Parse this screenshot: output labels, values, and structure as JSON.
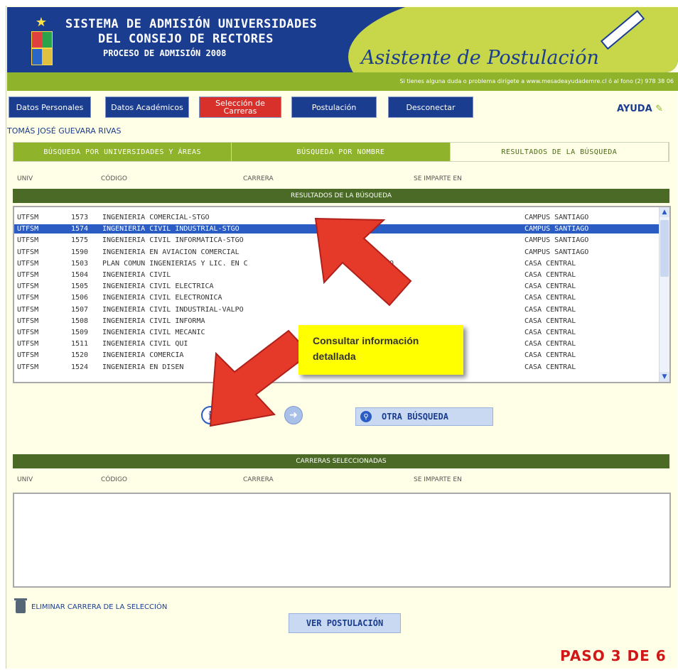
{
  "header": {
    "title_line1": "SISTEMA DE ADMISIÓN UNIVERSIDADES",
    "title_line2": "DEL CONSEJO DE RECTORES",
    "title_line3": "PROCESO DE ADMISIÓN 2008",
    "assistant_title": "Asistente de Postulación"
  },
  "infobar": {
    "text": "Si tienes alguna duda o problema dirígete a www.mesadeayudademre.cl ó al fono (2) 978 38 06"
  },
  "nav": {
    "items": [
      "Datos Personales",
      "Datos Académicos",
      "Selección de Carreras",
      "Postulación",
      "Desconectar"
    ],
    "help": "AYUDA"
  },
  "user": {
    "name": "TOMÁS JOSÉ GUEVARA RIVAS"
  },
  "tabs": [
    "BÚSQUEDA POR UNIVERSIDADES Y ÁREAS",
    "BÚSQUEDA POR NOMBRE",
    "RESULTADOS DE LA BÚSQUEDA"
  ],
  "columns": [
    "UNIV",
    "CÓDIGO",
    "CARRERA",
    "SE IMPARTE EN"
  ],
  "results": {
    "title": "RESULTADOS DE LA BÚSQUEDA",
    "rows": [
      {
        "univ": "UTFSM",
        "code": "1573",
        "career": "INGENIERIA COMERCIAL-STGO",
        "place": "CAMPUS SANTIAGO"
      },
      {
        "univ": "UTFSM",
        "code": "1574",
        "career": "INGENIERIA CIVIL INDUSTRIAL-STGO",
        "place": "CAMPUS SANTIAGO"
      },
      {
        "univ": "UTFSM",
        "code": "1575",
        "career": "INGENIERIA CIVIL INFORMATICA-STGO",
        "place": "CAMPUS SANTIAGO"
      },
      {
        "univ": "UTFSM",
        "code": "1590",
        "career": "INGENIERIA EN AVIACION COMERCIAL",
        "place": "CAMPUS SANTIAGO"
      },
      {
        "univ": "UTFSM",
        "code": "1503",
        "career": "PLAN COMUN INGENIERIAS Y LIC. EN C",
        "career_end": "LPO",
        "place": "CASA CENTRAL"
      },
      {
        "univ": "UTFSM",
        "code": "1504",
        "career": "INGENIERIA CIVIL",
        "place": "CASA CENTRAL"
      },
      {
        "univ": "UTFSM",
        "code": "1505",
        "career": "INGENIERIA CIVIL ELECTRICA",
        "place": "CASA CENTRAL"
      },
      {
        "univ": "UTFSM",
        "code": "1506",
        "career": "INGENIERIA CIVIL ELECTRONICA",
        "place": "CASA CENTRAL"
      },
      {
        "univ": "UTFSM",
        "code": "1507",
        "career": "INGENIERIA CIVIL INDUSTRIAL-VALPO",
        "place": "CASA CENTRAL"
      },
      {
        "univ": "UTFSM",
        "code": "1508",
        "career": "INGENIERIA CIVIL INFORMA",
        "place": "CASA CENTRAL"
      },
      {
        "univ": "UTFSM",
        "code": "1509",
        "career": "INGENIERIA CIVIL MECANIC",
        "place": "CASA CENTRAL"
      },
      {
        "univ": "UTFSM",
        "code": "1511",
        "career": "INGENIERIA CIVIL QUI",
        "place": "CASA CENTRAL"
      },
      {
        "univ": "UTFSM",
        "code": "1520",
        "career": "INGENIERIA COMERCIA",
        "place": "CASA CENTRAL"
      },
      {
        "univ": "UTFSM",
        "code": "1524",
        "career": "INGENIERIA EN DISEN",
        "place": "CASA CENTRAL"
      }
    ],
    "selected_index": 1
  },
  "tooltip": {
    "text": "Consultar información detallada"
  },
  "actions": {
    "info_glyph": "i",
    "other_search": "OTRA BÚSQUEDA"
  },
  "selected": {
    "title": "CARRERAS SELECCIONADAS"
  },
  "footer": {
    "remove": "ELIMINAR CARRERA DE LA SELECCIÓN",
    "view": "VER POSTULACIÓN",
    "step": "PASO 3 DE 6"
  },
  "colors": {
    "brand_blue": "#1b3d8f",
    "green": "#8fb32a",
    "dark_green": "#4a6a25",
    "active_red": "#d8302a",
    "selection_blue": "#2b5cc4",
    "tooltip_yellow": "#ffff00",
    "arrow_red": "#e53a2a"
  }
}
